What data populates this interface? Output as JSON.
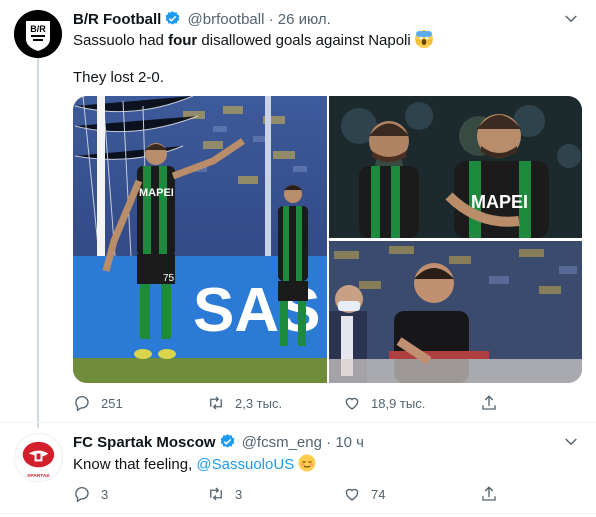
{
  "colors": {
    "accent": "#1d9bf0",
    "muted": "#536471",
    "text": "#0f1419"
  },
  "tweets": [
    {
      "author_name": "B/R Football",
      "avatar_text": "B/R",
      "handle": "@brfootball",
      "separator": "·",
      "date": "26 июл.",
      "text_before": "Sassuolo had ",
      "text_bold": "four",
      "text_after": " disallowed goals against Napoli",
      "text_line2": "They lost 2-0.",
      "media": {
        "left_shirt": "MAPEI",
        "left_number": "75",
        "board_text": "SAS",
        "top_right_shirt": "MAPEI",
        "icon_names": [
          "photo-left",
          "photo-top-right",
          "photo-bottom-right"
        ]
      },
      "replies": "251",
      "retweets": "2,3 тыс.",
      "likes": "18,9 тыс."
    },
    {
      "author_name": "FC Spartak Moscow",
      "avatar_text": "SPARTAK",
      "handle": "@fcsm_eng",
      "separator": "·",
      "date": "10 ч",
      "text_before": "Know that feeling, ",
      "mention": "@SassuoloUS",
      "replies": "3",
      "retweets": "3",
      "likes": "74"
    }
  ]
}
